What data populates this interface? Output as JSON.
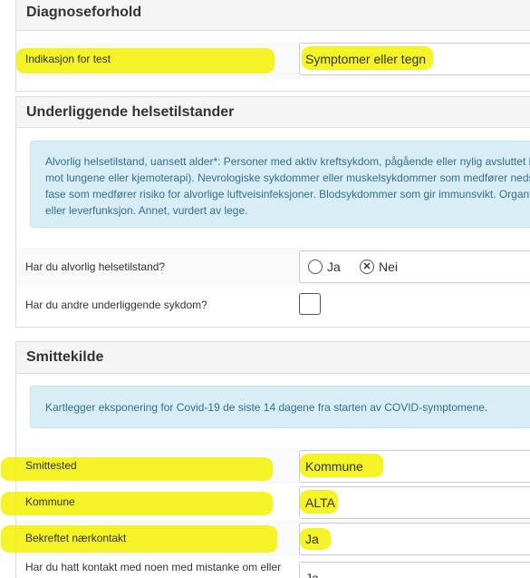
{
  "diagnose": {
    "title": "Diagnoseforhold",
    "indication_label": "Indikasjon for test",
    "indication_value": "Symptomer eller tegn"
  },
  "health": {
    "title": "Underliggende helsetilstander",
    "info_lines": [
      "Alvorlig helsetilstand, uansett alder*: Personer med aktiv kreftsykdom, pågående eller nylig avsluttet b",
      "mot lungene eller kjemoterapi). Nevrologiske sykdommer eller muskelsykdommer som medfører neds",
      "fase som medfører risiko for alvorlige luftveisinfeksjoner. Blodsykdommer som gir immunsvikt. Organt",
      "eller leverfunksjon. Annet, vurdert av lege."
    ],
    "serious_label": "Har du alvorlig helsetilstand?",
    "serious_options": [
      "Ja",
      "Nei"
    ],
    "serious_selected": "Nei",
    "other_label": "Har du andre underliggende sykdom?"
  },
  "infection": {
    "title": "Smittekilde",
    "info": "Kartlegger eksponering for Covid-19 de siste 14 dagene fra starten av COVID-symptomene.",
    "place_label": "Smittested",
    "place_value": "Kommune",
    "municipality_label": "Kommune",
    "municipality_value": "ALTA",
    "contact_label": "Bekreftet nærkontakt",
    "contact_value": "Ja",
    "suspect_label_line1": "Har du hatt kontakt med noen med mistanke om eller",
    "suspect_value": "Ja"
  },
  "colors": {
    "highlight": "#f2f200",
    "info_bg": "#d9edf7",
    "info_text": "#31708f"
  }
}
